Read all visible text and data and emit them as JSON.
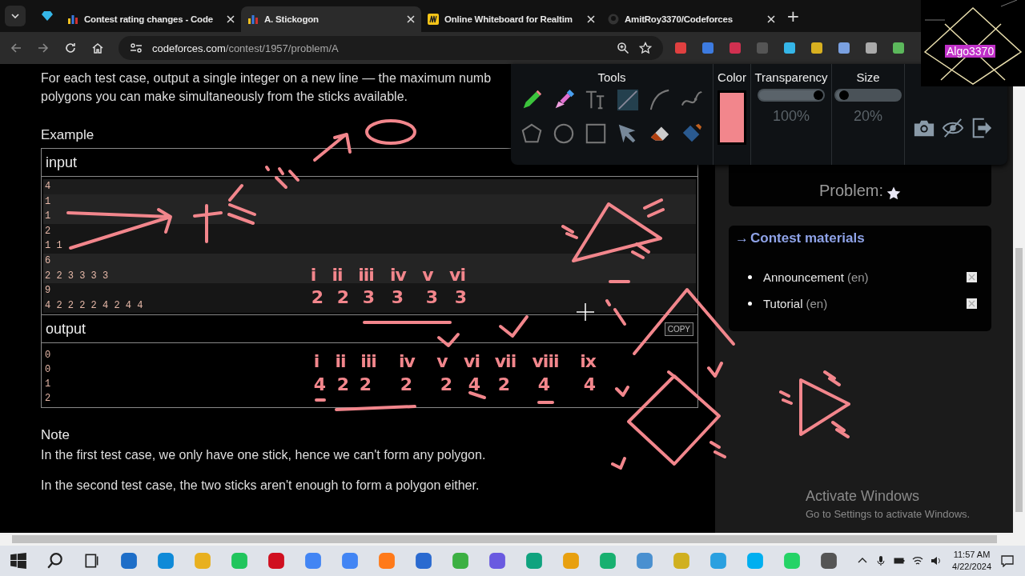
{
  "browser": {
    "tabs": [
      {
        "title": "Contest rating changes - Code",
        "selected": false
      },
      {
        "title": "A. Stickogon",
        "selected": true
      },
      {
        "title": "Online Whiteboard for Realtim",
        "selected": false
      },
      {
        "title": "AmitRoy3370/Codeforces",
        "selected": false
      }
    ],
    "new_tab": "+",
    "address": {
      "host": "codeforces.com",
      "path": "/contest/1957/problem/A"
    }
  },
  "problem": {
    "output_lines": [
      "For each test case, output a single integer on a new line — the maximum numb",
      "polygons you can make simultaneously from the sticks available."
    ],
    "example": {
      "title": "Example",
      "input": {
        "label": "input",
        "groups": [
          [
            "4"
          ],
          [
            "1",
            "1"
          ],
          [
            "2",
            "1 1"
          ],
          [
            "6",
            "2 2 3 3 3 3"
          ],
          [
            "9",
            "4 2 2 2 2 4 2 4 4"
          ]
        ]
      },
      "output": {
        "label": "output",
        "copy": "COPY",
        "lines": [
          "0",
          "0",
          "1",
          "2"
        ]
      }
    },
    "note": {
      "title": "Note",
      "paragraphs": [
        "In the first test case, we only have one stick, hence we can't form any polygon.",
        "In the second test case, the two sticks aren't enough to form a polygon either."
      ]
    }
  },
  "sidebar": {
    "problem_label": "Problem:",
    "materials": {
      "arrow": "→",
      "title": "Contest materials",
      "items": [
        {
          "name": "Announcement",
          "lang": "(en)"
        },
        {
          "name": "Tutorial",
          "lang": "(en)"
        }
      ]
    }
  },
  "whiteboard": {
    "tools_label": "Tools",
    "color_label": "Color",
    "color": "#f2868c",
    "transparency": {
      "label": "Transparency",
      "level": 1.0,
      "reading": "100%"
    },
    "size": {
      "label": "Size",
      "level": 0.2,
      "reading": "20%"
    }
  },
  "annotations": {
    "input_labels": [
      "i",
      "ii",
      "iii",
      "iv",
      "v",
      "vi"
    ],
    "input_counts": [
      "2",
      "2",
      "3",
      "3",
      "3",
      "3"
    ],
    "output_labels": [
      "i",
      "ii",
      "iii",
      "iv",
      "v",
      "vi",
      "vii",
      "viii",
      "ix"
    ],
    "output_counts": [
      "4",
      "2",
      "2",
      "2",
      "2",
      "4",
      "2",
      "4",
      "4"
    ]
  },
  "logo": "Algo3370",
  "activation": {
    "title": "Activate Windows",
    "text": "Go to Settings to activate Windows."
  },
  "taskbar": {
    "time": "11:57 AM",
    "date": "4/22/2024"
  }
}
